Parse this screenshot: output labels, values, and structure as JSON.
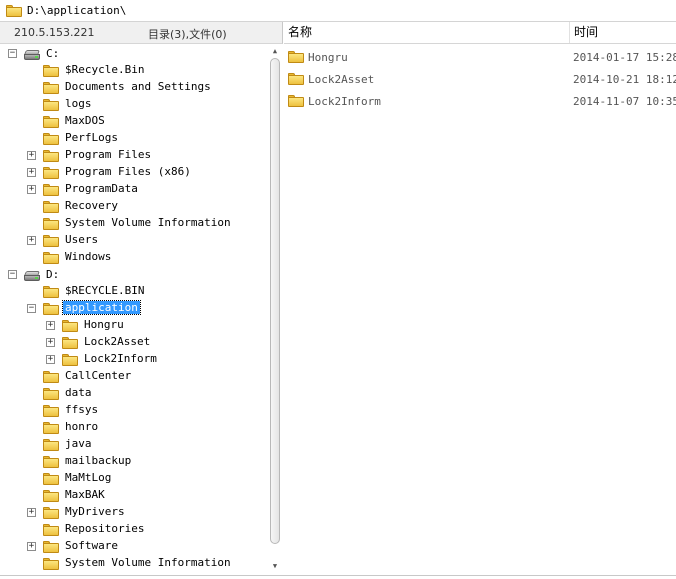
{
  "path_bar": {
    "path": "D:\\application\\"
  },
  "status": {
    "ip": "210.5.153.221",
    "counts": "目录(3),文件(0)"
  },
  "list_header": {
    "name_col": "名称",
    "time_col": "时间"
  },
  "tree": [
    {
      "label": "C:",
      "type": "drive",
      "level": 0,
      "expander": "−"
    },
    {
      "label": "$Recycle.Bin",
      "type": "folder",
      "level": 1,
      "expander": ""
    },
    {
      "label": "Documents and Settings",
      "type": "folder",
      "level": 1,
      "expander": ""
    },
    {
      "label": "logs",
      "type": "folder",
      "level": 1,
      "expander": ""
    },
    {
      "label": "MaxDOS",
      "type": "folder",
      "level": 1,
      "expander": ""
    },
    {
      "label": "PerfLogs",
      "type": "folder",
      "level": 1,
      "expander": ""
    },
    {
      "label": "Program Files",
      "type": "folder",
      "level": 1,
      "expander": "+"
    },
    {
      "label": "Program Files (x86)",
      "type": "folder",
      "level": 1,
      "expander": "+"
    },
    {
      "label": "ProgramData",
      "type": "folder",
      "level": 1,
      "expander": "+"
    },
    {
      "label": "Recovery",
      "type": "folder",
      "level": 1,
      "expander": ""
    },
    {
      "label": "System Volume Information",
      "type": "folder",
      "level": 1,
      "expander": ""
    },
    {
      "label": "Users",
      "type": "folder",
      "level": 1,
      "expander": "+"
    },
    {
      "label": "Windows",
      "type": "folder",
      "level": 1,
      "expander": ""
    },
    {
      "label": "D:",
      "type": "drive",
      "level": 0,
      "expander": "−"
    },
    {
      "label": "$RECYCLE.BIN",
      "type": "folder",
      "level": 1,
      "expander": ""
    },
    {
      "label": "application",
      "type": "folder",
      "level": 1,
      "expander": "−",
      "selected": true
    },
    {
      "label": "Hongru",
      "type": "folder",
      "level": 2,
      "expander": "+"
    },
    {
      "label": "Lock2Asset",
      "type": "folder",
      "level": 2,
      "expander": "+"
    },
    {
      "label": "Lock2Inform",
      "type": "folder",
      "level": 2,
      "expander": "+"
    },
    {
      "label": "CallCenter",
      "type": "folder",
      "level": 1,
      "expander": ""
    },
    {
      "label": "data",
      "type": "folder",
      "level": 1,
      "expander": ""
    },
    {
      "label": "ffsys",
      "type": "folder",
      "level": 1,
      "expander": ""
    },
    {
      "label": "honro",
      "type": "folder",
      "level": 1,
      "expander": ""
    },
    {
      "label": "java",
      "type": "folder",
      "level": 1,
      "expander": ""
    },
    {
      "label": "mailbackup",
      "type": "folder",
      "level": 1,
      "expander": ""
    },
    {
      "label": "MaMtLog",
      "type": "folder",
      "level": 1,
      "expander": ""
    },
    {
      "label": "MaxBAK",
      "type": "folder",
      "level": 1,
      "expander": ""
    },
    {
      "label": "MyDrivers",
      "type": "folder",
      "level": 1,
      "expander": "+"
    },
    {
      "label": "Repositories",
      "type": "folder",
      "level": 1,
      "expander": ""
    },
    {
      "label": "Software",
      "type": "folder",
      "level": 1,
      "expander": "+"
    },
    {
      "label": "System Volume Information",
      "type": "folder",
      "level": 1,
      "expander": ""
    }
  ],
  "list": [
    {
      "name": "Hongru",
      "time": "2014-01-17 15:28:"
    },
    {
      "name": "Lock2Asset",
      "time": "2014-10-21 18:12:"
    },
    {
      "name": "Lock2Inform",
      "time": "2014-11-07 10:35:"
    }
  ],
  "scrollbar": {
    "up_glyph": "▲",
    "down_glyph": "▼"
  },
  "colors": {
    "selection": "#3399ff",
    "folder": "#edc13f",
    "header_bg": "#f0f0f0"
  }
}
